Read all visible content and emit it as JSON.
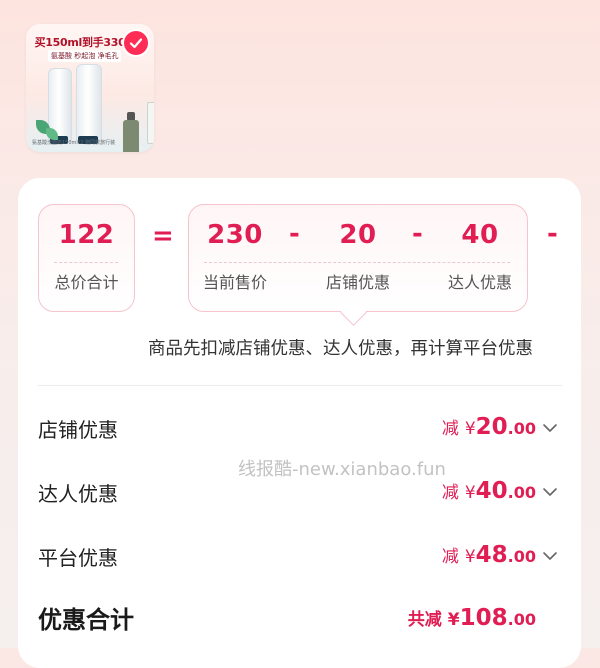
{
  "product": {
    "promo_text": "买150ml到手330",
    "promo_sub": "氨基酸 秒起泡 净毛孔",
    "brand_text": "ORIGINS",
    "footnote": "氨基酸洗面奶150ml*2 赠同款旅行装",
    "selected": true
  },
  "formula": {
    "total": {
      "value": "122",
      "label": "总价合计"
    },
    "equals": "=",
    "minus": "-",
    "terms": [
      {
        "value": "230",
        "label": "当前售价"
      },
      {
        "value": "20",
        "label": "店铺优惠"
      },
      {
        "value": "40",
        "label": "达人优惠"
      }
    ]
  },
  "note": "商品先扣减店铺优惠、达人优惠，再计算平台优惠",
  "discounts": [
    {
      "label": "店铺优惠",
      "prefix": "减",
      "currency": "¥",
      "int": "20",
      "dec": ".00"
    },
    {
      "label": "达人优惠",
      "prefix": "减",
      "currency": "¥",
      "int": "40",
      "dec": ".00"
    },
    {
      "label": "平台优惠",
      "prefix": "减",
      "currency": "¥",
      "int": "48",
      "dec": ".00"
    }
  ],
  "total_discount": {
    "label": "优惠合计",
    "prefix": "共减",
    "currency": "¥",
    "int": "108",
    "dec": ".00"
  },
  "watermark": "线报酷-new.xianbao.fun",
  "colors": {
    "accent": "#e01e54",
    "border": "#f5c4cc",
    "check": "#ff2d55"
  }
}
